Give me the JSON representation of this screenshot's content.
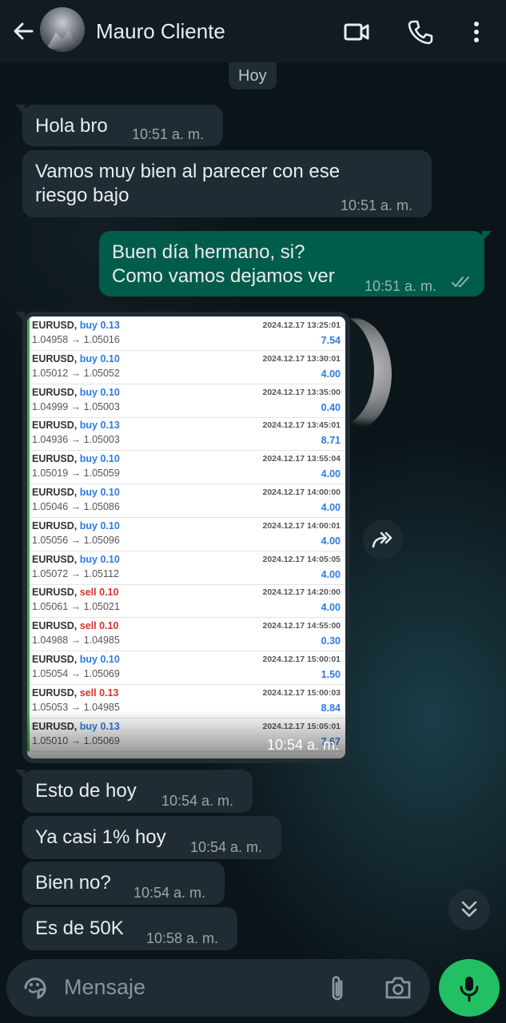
{
  "header": {
    "contact_name": "Mauro Cliente",
    "back_icon": "arrow-left-icon",
    "video_icon": "video-camera-icon",
    "call_icon": "phone-icon",
    "menu_icon": "more-vertical-icon"
  },
  "date_separator": "Hoy",
  "messages": [
    {
      "text": "Hola bro",
      "time": "10:51 a. m."
    },
    {
      "text": "Vamos muy bien al parecer con ese\nriesgo bajo",
      "time": "10:51 a. m."
    },
    {
      "text": "Buen día hermano, si?\nComo vamos dejamos ver",
      "time": "10:51 a. m."
    },
    {
      "text": "Esto de hoy",
      "time": "10:54 a. m."
    },
    {
      "text": "Ya casi 1% hoy",
      "time": "10:54 a. m."
    },
    {
      "text": "Bien no?",
      "time": "10:54 a. m."
    },
    {
      "text": "Es de 50K",
      "time": "10:58 a. m."
    }
  ],
  "image_message": {
    "time": "10:54 a. m.",
    "trades": [
      {
        "pair": "EURUSD,",
        "side": "buy",
        "lots": "0.13",
        "open": "1.04958",
        "close": "1.05016",
        "date": "2024.12.17 13:25:01",
        "profit": "7.54"
      },
      {
        "pair": "EURUSD,",
        "side": "buy",
        "lots": "0.10",
        "open": "1.05012",
        "close": "1.05052",
        "date": "2024.12.17 13:30:01",
        "profit": "4.00"
      },
      {
        "pair": "EURUSD,",
        "side": "buy",
        "lots": "0.10",
        "open": "1.04999",
        "close": "1.05003",
        "date": "2024.12.17 13:35:00",
        "profit": "0.40"
      },
      {
        "pair": "EURUSD,",
        "side": "buy",
        "lots": "0.13",
        "open": "1.04936",
        "close": "1.05003",
        "date": "2024.12.17 13:45:01",
        "profit": "8.71"
      },
      {
        "pair": "EURUSD,",
        "side": "buy",
        "lots": "0.10",
        "open": "1.05019",
        "close": "1.05059",
        "date": "2024.12.17 13:55:04",
        "profit": "4.00"
      },
      {
        "pair": "EURUSD,",
        "side": "buy",
        "lots": "0.10",
        "open": "1.05046",
        "close": "1.05086",
        "date": "2024.12.17 14:00:00",
        "profit": "4.00"
      },
      {
        "pair": "EURUSD,",
        "side": "buy",
        "lots": "0.10",
        "open": "1.05056",
        "close": "1.05096",
        "date": "2024.12.17 14:00:01",
        "profit": "4.00"
      },
      {
        "pair": "EURUSD,",
        "side": "buy",
        "lots": "0.10",
        "open": "1.05072",
        "close": "1.05112",
        "date": "2024.12.17 14:05:05",
        "profit": "4.00"
      },
      {
        "pair": "EURUSD,",
        "side": "sell",
        "lots": "0.10",
        "open": "1.05061",
        "close": "1.05021",
        "date": "2024.12.17 14:20:00",
        "profit": "4.00"
      },
      {
        "pair": "EURUSD,",
        "side": "sell",
        "lots": "0.10",
        "open": "1.04988",
        "close": "1.04985",
        "date": "2024.12.17 14:55:00",
        "profit": "0.30"
      },
      {
        "pair": "EURUSD,",
        "side": "buy",
        "lots": "0.10",
        "open": "1.05054",
        "close": "1.05069",
        "date": "2024.12.17 15:00:01",
        "profit": "1.50"
      },
      {
        "pair": "EURUSD,",
        "side": "sell",
        "lots": "0.13",
        "open": "1.05053",
        "close": "1.04985",
        "date": "2024.12.17 15:00:03",
        "profit": "8.84"
      },
      {
        "pair": "EURUSD,",
        "side": "buy",
        "lots": "0.13",
        "open": "1.05010",
        "close": "1.05069",
        "date": "2024.12.17 15:05:01",
        "profit": "7.67"
      }
    ]
  },
  "composer": {
    "placeholder": "Mensaje",
    "emoji_icon": "sticker-icon",
    "attach_icon": "paperclip-icon",
    "camera_icon": "camera-icon",
    "mic_icon": "microphone-icon"
  },
  "colors": {
    "incoming_bubble": "#1f2c33",
    "outgoing_bubble": "#005c4b",
    "accent_green": "#21c063",
    "buy_blue": "#2c7be5",
    "sell_red": "#d9342b"
  }
}
